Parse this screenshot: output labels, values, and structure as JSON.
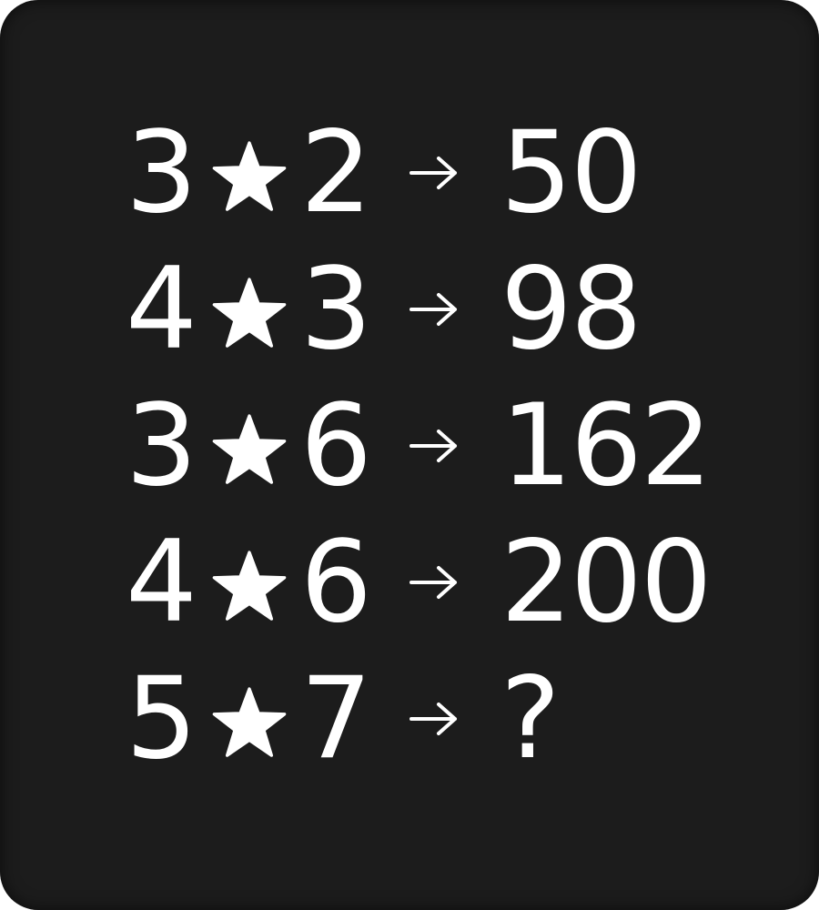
{
  "puzzle": {
    "operator_icon": "star-icon",
    "arrow_icon": "right-arrow-icon",
    "text_color": "#ffffff",
    "background_color": "#1c1c1c",
    "rows": [
      {
        "left": "3",
        "right": "2",
        "result": "50"
      },
      {
        "left": "4",
        "right": "3",
        "result": "98"
      },
      {
        "left": "3",
        "right": "6",
        "result": "162"
      },
      {
        "left": "4",
        "right": "6",
        "result": "200"
      },
      {
        "left": "5",
        "right": "7",
        "result": "?"
      }
    ]
  }
}
